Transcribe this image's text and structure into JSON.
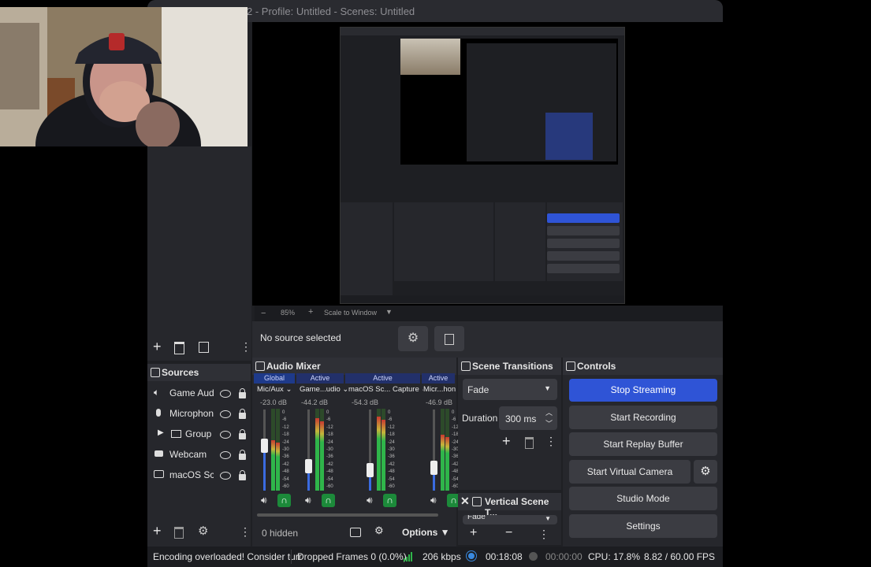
{
  "window": {
    "title": "2 - Profile: Untitled - Scenes: Untitled"
  },
  "preview": {
    "zoom": "85%",
    "scale_mode": "Scale to Window"
  },
  "source_toolbar": {
    "no_source": "No source selected"
  },
  "sources": {
    "title": "Sources",
    "items": [
      {
        "name": "Game Audi",
        "icon": "speaker-icon"
      },
      {
        "name": "Microphon",
        "icon": "microphone-icon"
      },
      {
        "name": "Group",
        "icon": "folder-icon"
      },
      {
        "name": "Webcam",
        "icon": "camera-icon"
      },
      {
        "name": "macOS Scr",
        "icon": "monitor-icon"
      }
    ]
  },
  "audio_mixer": {
    "title": "Audio Mixer",
    "hidden_count": "0 hidden",
    "options_label": "Options",
    "channels": [
      {
        "header": "Global",
        "name": "Mic/Aux",
        "db": "-23.0 dB",
        "level": 0.62,
        "fader": 0.55
      },
      {
        "header": "Active",
        "name": "Game...udio",
        "db": "-44.2 dB",
        "level": 0.88,
        "fader": 0.3
      },
      {
        "header": "Active",
        "name": "macOS Sc... Capture",
        "db": "-54.3 dB",
        "level": 0.9,
        "fader": 0.25
      },
      {
        "header": "Active",
        "name": "Micr...hon",
        "db": "-46.9 dB",
        "level": 0.68,
        "fader": 0.28
      }
    ],
    "ticks": [
      "0",
      "-6",
      "-12",
      "-18",
      "-24",
      "-30",
      "-36",
      "-42",
      "-48",
      "-54",
      "-60"
    ]
  },
  "scene_transitions": {
    "title": "Scene Transitions",
    "transition": "Fade",
    "duration_label": "Duration",
    "duration_value": "300 ms"
  },
  "vertical_scene": {
    "title": "Vertical Scene T...",
    "transition": "Fade"
  },
  "controls": {
    "title": "Controls",
    "stop_streaming": "Stop Streaming",
    "start_recording": "Start Recording",
    "start_replay": "Start Replay Buffer",
    "start_virtual_cam": "Start Virtual Camera",
    "studio_mode": "Studio Mode",
    "settings": "Settings"
  },
  "status": {
    "warning": "Encoding overloaded! Consider turr",
    "dropped": "Dropped Frames 0 (0.0%)",
    "bitrate": "206 kbps",
    "stream_time": "00:18:08",
    "rec_time": "00:00:00",
    "cpu": "CPU: 17.8%",
    "fps": "8.82 / 60.00 FPS"
  },
  "colors": {
    "accent": "#2f54d6",
    "active_green": "#1c8a3a"
  }
}
